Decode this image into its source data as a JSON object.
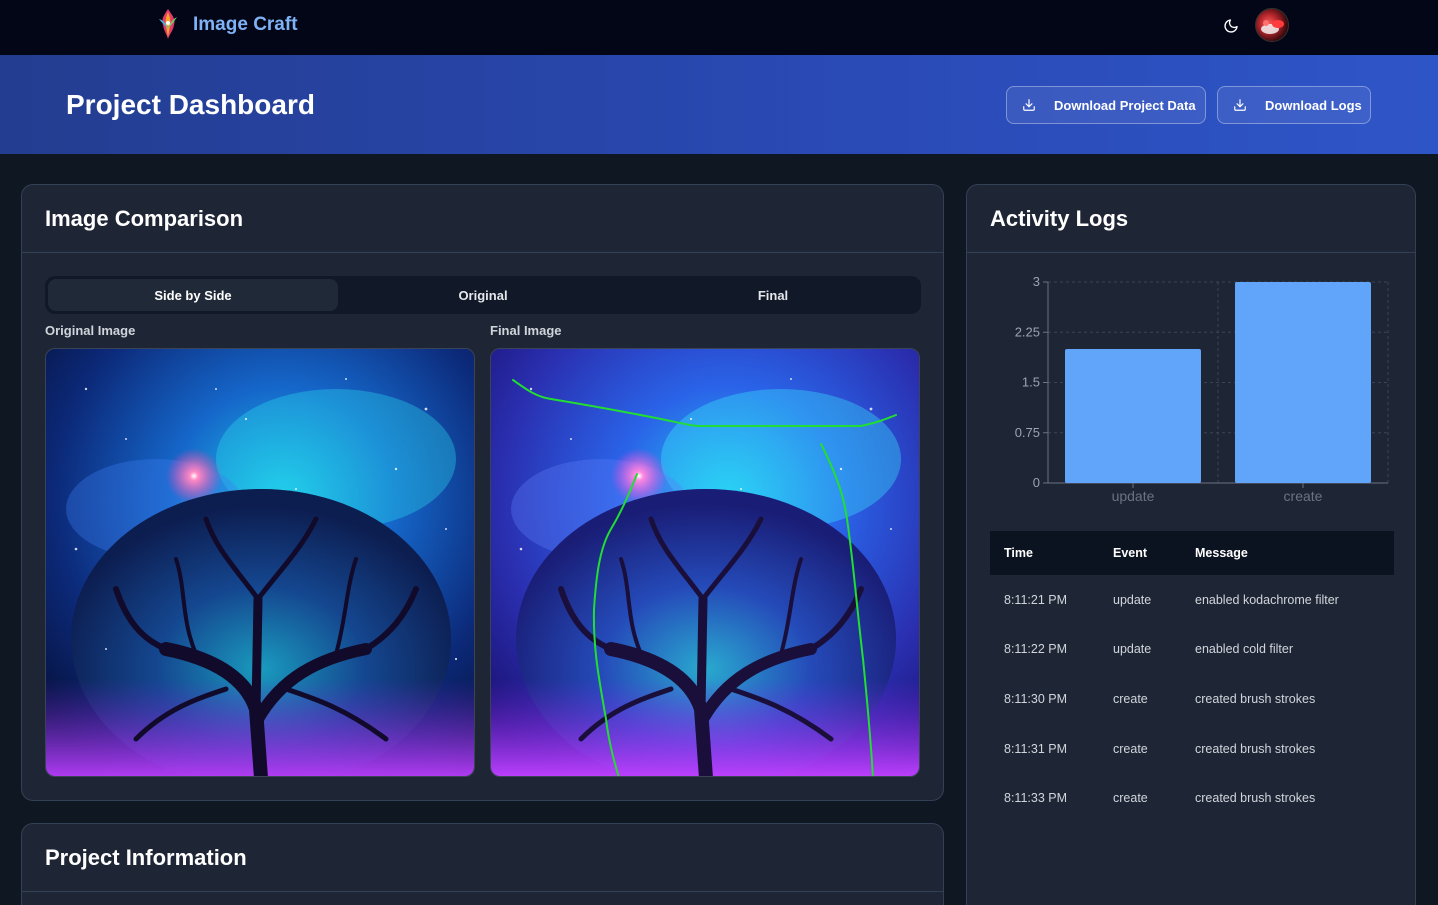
{
  "nav": {
    "brand": "Image Craft",
    "theme_icon": "moon-icon",
    "avatar_icon": "user-avatar"
  },
  "banner": {
    "title": "Project Dashboard",
    "download_data_label": "Download Project Data",
    "download_logs_label": "Download Logs",
    "download_icon": "download-icon"
  },
  "comparison": {
    "title": "Image Comparison",
    "tabs": [
      {
        "label": "Side by Side",
        "active": true
      },
      {
        "label": "Original",
        "active": false
      },
      {
        "label": "Final",
        "active": false
      }
    ],
    "original_label": "Original Image",
    "final_label": "Final Image"
  },
  "info": {
    "title": "Project Information"
  },
  "logs": {
    "title": "Activity Logs",
    "columns": [
      "Time",
      "Event",
      "Message"
    ],
    "rows": [
      {
        "time": "8:11:21 PM",
        "event": "update",
        "message": "enabled kodachrome filter"
      },
      {
        "time": "8:11:22 PM",
        "event": "update",
        "message": "enabled cold filter"
      },
      {
        "time": "8:11:30 PM",
        "event": "create",
        "message": "created brush strokes"
      },
      {
        "time": "8:11:31 PM",
        "event": "create",
        "message": "created brush strokes"
      },
      {
        "time": "8:11:33 PM",
        "event": "create",
        "message": "created brush strokes"
      }
    ]
  },
  "chart_data": {
    "type": "bar",
    "categories": [
      "update",
      "create"
    ],
    "values": [
      2,
      3
    ],
    "yticks": [
      "0",
      "0.75",
      "1.5",
      "2.25",
      "3"
    ],
    "ylim": [
      0,
      3
    ],
    "grid": true,
    "bar_color": "#60a5fa"
  }
}
